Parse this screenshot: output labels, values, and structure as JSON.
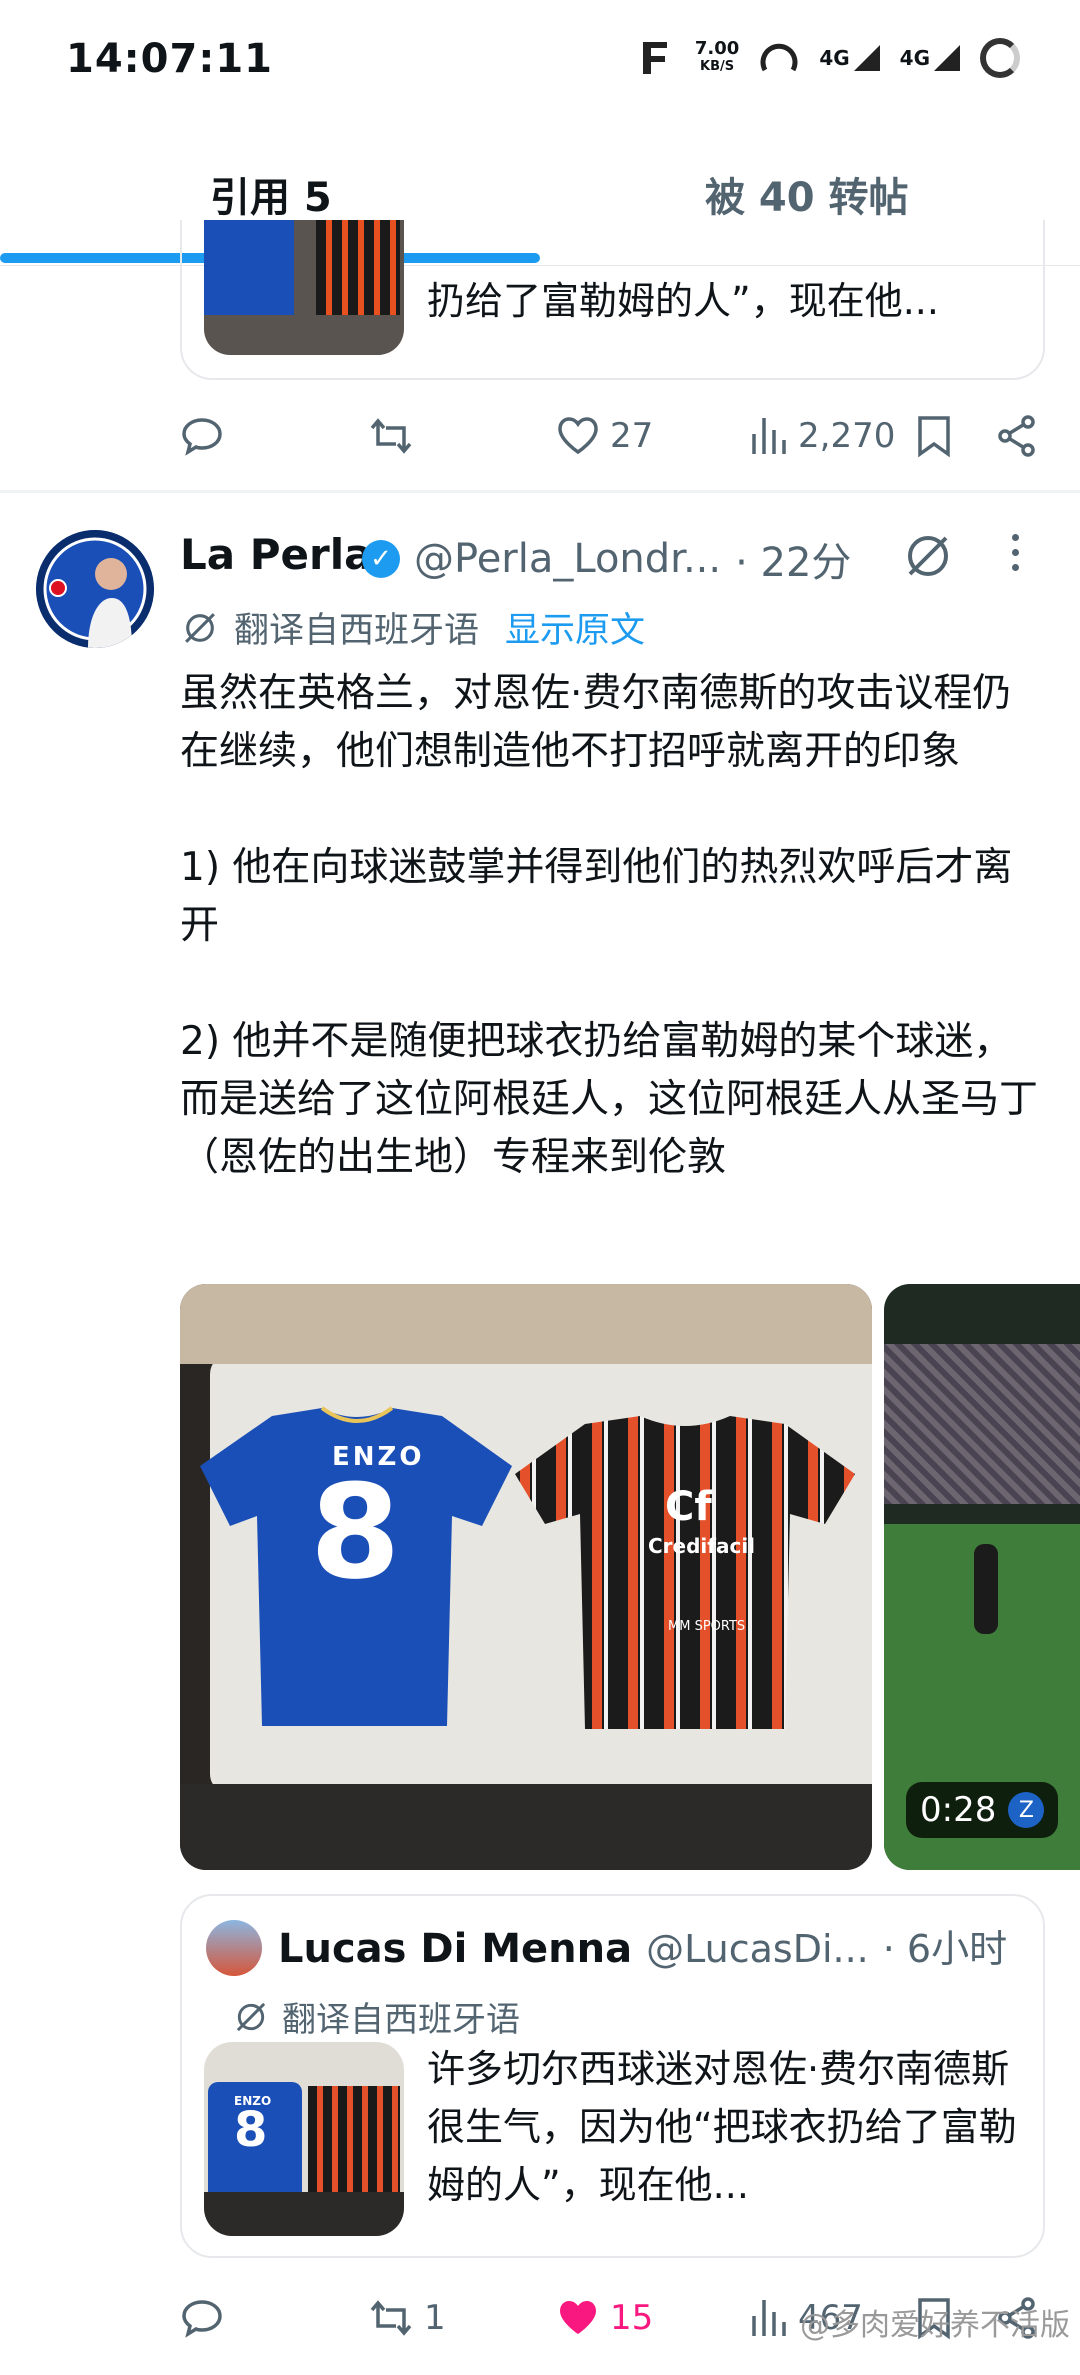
{
  "status": {
    "time": "14:07:11",
    "speed_value": "7.00",
    "speed_unit": "KB/S",
    "signal1": "4G",
    "signal2": "4G"
  },
  "tabs": [
    {
      "label": "引用 5",
      "active": true
    },
    {
      "label": "被 40 转帖",
      "active": false
    }
  ],
  "top_quote": {
    "text": "扔给了富勒姆的人”，现在他..."
  },
  "top_actions": {
    "likes": "27",
    "views": "2,270"
  },
  "tweet": {
    "name": "La Perla",
    "handle": "@Perla_Londr...",
    "time": "· 22分",
    "translate_label": "翻译自西班牙语",
    "show_original": "显示原文",
    "body": "虽然在英格兰，对恩佐·费尔南德斯的攻击议程仍在继续，他们想制造他不打招呼就离开的印象\n\n1) 他在向球迷鼓掌并得到他们的热烈欢呼后才离开\n\n2) 他并不是随便把球衣扔给富勒姆的某个球迷，而是送给了这位阿根廷人，这位阿根廷人从圣马丁（恩佐的出生地）专程来到伦敦",
    "video_duration": "0:28",
    "video_badge": "Z",
    "jersey_left": {
      "name": "ENZO",
      "number": "8"
    },
    "jersey_right": {
      "sponsor": "Credifacil",
      "logo": "Cf",
      "brand": "MM SPORTS"
    },
    "quote": {
      "name": "Lucas Di Menna",
      "handle": "@LucasDi...",
      "time": "· 6小时",
      "translate_label": "翻译自西班牙语",
      "text": "许多切尔西球迷对恩佐·费尔南德斯很生气，因为他“把球衣扔给了富勒姆的人”，现在他...",
      "thumb_jersey_name": "ENZO",
      "thumb_jersey_number": "8"
    },
    "actions": {
      "retweets": "1",
      "likes": "15",
      "views": "467"
    }
  },
  "watermark": "@多肉爱好养不活版",
  "colors": {
    "accent": "#1d9bf0",
    "like_active": "#f91880",
    "chelsea_blue": "#1b4fb8"
  }
}
